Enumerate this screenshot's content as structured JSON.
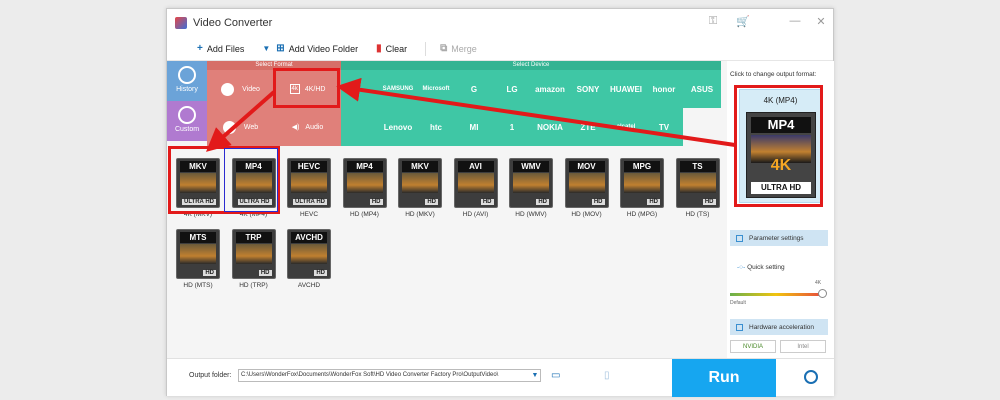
{
  "window": {
    "title": "Video Converter"
  },
  "toolbar": {
    "add_files": "Add Files",
    "add_video_folder": "Add Video Folder",
    "clear": "Clear",
    "merge": "Merge"
  },
  "sidebar": {
    "history": "History",
    "custom": "Custom"
  },
  "format_panel": {
    "select_format_header": "Select Format",
    "select_device_header": "Select Device",
    "formats": [
      {
        "label": "Video"
      },
      {
        "label": "4K/HD"
      },
      {
        "label": "Web"
      },
      {
        "label": "Audio"
      }
    ],
    "devices_row1": [
      "",
      "SAMSUNG",
      "Microsoft",
      "G",
      "LG",
      "amazon",
      "SONY",
      "HUAWEI",
      "honor",
      "ASUS"
    ],
    "devices_row2": [
      "",
      "Lenovo",
      "htc",
      "MI",
      "1",
      "NOKIA",
      "ZTE",
      "alcatel",
      "TV"
    ]
  },
  "grid": {
    "items": [
      {
        "tag": "MKV",
        "badge": "ULTRA HD",
        "caption": "4K (MKV)"
      },
      {
        "tag": "MP4",
        "badge": "ULTRA HD",
        "caption": "4K (MP4)"
      },
      {
        "tag": "HEVC",
        "badge": "ULTRA HD",
        "caption": "HEVC"
      },
      {
        "tag": "MP4",
        "badge": "HD",
        "caption": "HD (MP4)"
      },
      {
        "tag": "MKV",
        "badge": "HD",
        "caption": "HD (MKV)"
      },
      {
        "tag": "AVI",
        "badge": "HD",
        "caption": "HD (AVI)"
      },
      {
        "tag": "WMV",
        "badge": "HD",
        "caption": "HD (WMV)"
      },
      {
        "tag": "MOV",
        "badge": "HD",
        "caption": "HD (MOV)"
      },
      {
        "tag": "MPG",
        "badge": "HD",
        "caption": "HD (MPG)"
      },
      {
        "tag": "TS",
        "badge": "HD",
        "caption": "HD (TS)"
      },
      {
        "tag": "MTS",
        "badge": "HD",
        "caption": "HD (MTS)"
      },
      {
        "tag": "TRP",
        "badge": "HD",
        "caption": "HD (TRP)"
      },
      {
        "tag": "AVCHD",
        "badge": "HD",
        "caption": "AVCHD"
      }
    ]
  },
  "right_panel": {
    "hint": "Click to change output format:",
    "selected": "4K (MP4)",
    "preview_tag": "MP4",
    "preview_4k": "4K",
    "preview_badge": "ULTRA HD",
    "parameter_settings": "Parameter settings",
    "quick_setting": "Quick setting",
    "slider_max_label": "4K",
    "slider_min_label": "Default",
    "slider_level": 1.0,
    "hardware_acceleration": "Hardware acceleration",
    "nvidia": "NVIDIA",
    "intel": "Intel"
  },
  "bottom": {
    "output_folder_label": "Output folder:",
    "output_folder_path": "C:\\Users\\WonderFox\\Documents\\WonderFox Soft\\HD Video Converter Factory Pro\\OutputVideo\\",
    "run": "Run"
  },
  "colors": {
    "format_bg": "#e0807a",
    "device_bg": "#3fc7a5",
    "history_bg": "#6ba3d8",
    "custom_bg": "#b07ad0",
    "run_bg": "#16a6f0",
    "highlight": "#e21a1a"
  }
}
